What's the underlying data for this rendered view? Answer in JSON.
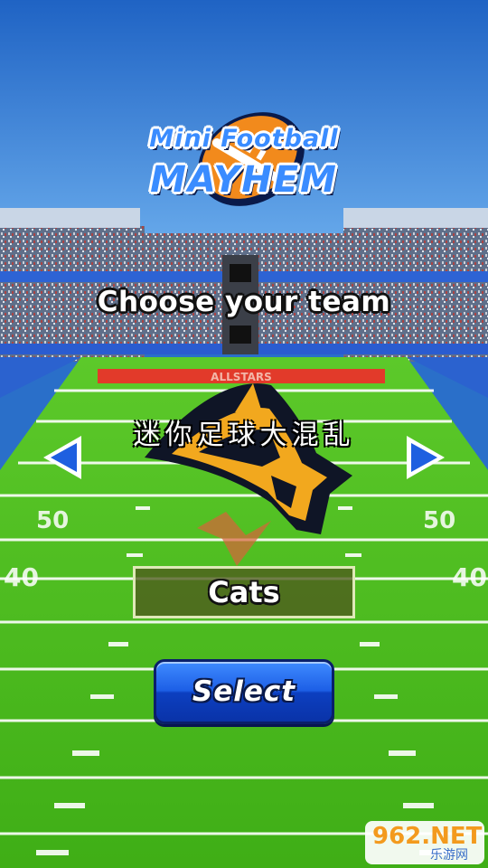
{
  "game": {
    "logo_line1": "Mini Football",
    "logo_line2": "MAYHEM",
    "screen_title": "Choose your team",
    "field_banner": "ALLSTARS",
    "yard_left": "50",
    "yard_right": "50",
    "yard_left2": "40",
    "yard_right2": "40"
  },
  "team": {
    "name": "Cats",
    "logo_icon": "cat-mascot-icon"
  },
  "watermark": {
    "cn_text": "迷你足球大混乱",
    "site_main": "962.NET",
    "site_sub": "乐游网"
  },
  "buttons": {
    "select_label": "Select",
    "prev_icon": "left-arrow-icon",
    "next_icon": "right-arrow-icon"
  },
  "colors": {
    "sky": "#2a6fc9",
    "field": "#4fbf1f",
    "arrow": "#1e5fe0",
    "button": "#1d5fe6",
    "banner": "#e23a2a"
  }
}
